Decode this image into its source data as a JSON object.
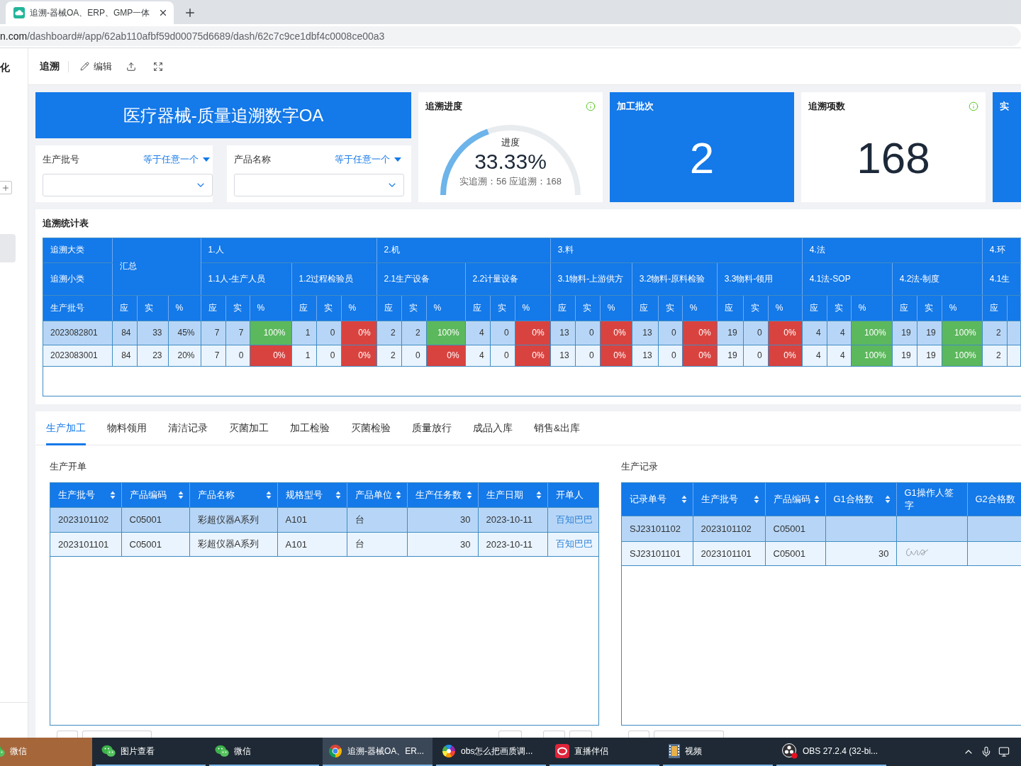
{
  "browser": {
    "tab": {
      "title": "追溯-器械OA、ERP、GMP一体"
    },
    "url": {
      "host": "n.com",
      "path": "/dashboard#/app/62ab110afbf59d00075d6689/dash/62c7c9ce1dbf4c0008ce00a3"
    }
  },
  "sidebar": {
    "title": "化",
    "items": [
      {
        "selected": true
      }
    ]
  },
  "toolbar": {
    "title": "追溯",
    "actions": [
      {
        "kind": "edit",
        "label": "编辑"
      },
      {
        "kind": "share"
      },
      {
        "kind": "fullscreen"
      }
    ]
  },
  "banner": {
    "title": "医疗器械-质量追溯数字OA"
  },
  "filters": [
    {
      "label": "生产批号",
      "operator": "等于任意一个"
    },
    {
      "label": "产品名称",
      "operator": "等于任意一个"
    }
  ],
  "progress_card": {
    "title": "追溯进度",
    "info": true,
    "caption": "进度",
    "value": "33.33%",
    "level": 0.3333,
    "detail": "实追溯：56 应追溯：168"
  },
  "stat_cards": [
    {
      "title": "加工批次",
      "value": "2",
      "kind": "filled",
      "info": false
    },
    {
      "title": "追溯项数",
      "value": "168",
      "kind": "plain",
      "info": true
    },
    {
      "title": "实",
      "kind": "filled",
      "info": false
    }
  ],
  "stats_table": {
    "title": "追溯统计表",
    "corner_labels": [
      "追溯大类",
      "追溯小类",
      "生产批号"
    ],
    "total": {
      "label": "汇总",
      "columns": [
        "应",
        "实",
        "%"
      ]
    },
    "categories": [
      {
        "label": "1.人",
        "subcategories": [
          {
            "label": "1.1人-生产人员",
            "columns": [
              "应",
              "实",
              "%"
            ]
          },
          {
            "label": "1.2过程检验员",
            "columns": [
              "应",
              "实",
              "%"
            ]
          }
        ]
      },
      {
        "label": "2.机",
        "subcategories": [
          {
            "label": "2.1生产设备",
            "columns": [
              "应",
              "实",
              "%"
            ]
          },
          {
            "label": "2.2计量设备",
            "columns": [
              "应",
              "实",
              "%"
            ]
          }
        ]
      },
      {
        "label": "3.料",
        "subcategories": [
          {
            "label": "3.1物料-上游供方",
            "columns": [
              "应",
              "实",
              "%"
            ]
          },
          {
            "label": "3.2物料-原料检验",
            "columns": [
              "应",
              "实",
              "%"
            ]
          },
          {
            "label": "3.3物料-领用",
            "columns": [
              "应",
              "实",
              "%"
            ]
          }
        ]
      },
      {
        "label": "4.法",
        "subcategories": [
          {
            "label": "4.1法-SOP",
            "columns": [
              "应",
              "实",
              "%"
            ]
          },
          {
            "label": "4.2法-制度",
            "columns": [
              "应",
              "实",
              "%"
            ]
          }
        ]
      },
      {
        "label": "4.环",
        "subcategories": [
          {
            "label": "4.1生",
            "columns": [
              "应"
            ]
          }
        ]
      }
    ],
    "rows": [
      {
        "batch": "2023082801",
        "selected": true,
        "total": {
          "due": "84",
          "done": "33",
          "percent": "45%"
        },
        "cells": [
          {
            "due": "7",
            "done": "7",
            "percent": "100%",
            "complete": true
          },
          {
            "due": "1",
            "done": "0",
            "percent": "0%",
            "complete": false
          },
          {
            "due": "2",
            "done": "2",
            "percent": "100%",
            "complete": true
          },
          {
            "due": "4",
            "done": "0",
            "percent": "0%",
            "complete": false
          },
          {
            "due": "13",
            "done": "0",
            "percent": "0%",
            "complete": false
          },
          {
            "due": "13",
            "done": "0",
            "percent": "0%",
            "complete": false
          },
          {
            "due": "19",
            "done": "0",
            "percent": "0%",
            "complete": false
          },
          {
            "due": "4",
            "done": "4",
            "percent": "100%",
            "complete": true
          },
          {
            "due": "19",
            "done": "19",
            "percent": "100%",
            "complete": true
          },
          {
            "due": "2"
          }
        ]
      },
      {
        "batch": "2023083001",
        "selected": false,
        "total": {
          "due": "84",
          "done": "23",
          "percent": "20%"
        },
        "cells": [
          {
            "due": "7",
            "done": "0",
            "percent": "0%",
            "complete": false
          },
          {
            "due": "1",
            "done": "0",
            "percent": "0%",
            "complete": false
          },
          {
            "due": "2",
            "done": "0",
            "percent": "0%",
            "complete": false
          },
          {
            "due": "4",
            "done": "0",
            "percent": "0%",
            "complete": false
          },
          {
            "due": "13",
            "done": "0",
            "percent": "0%",
            "complete": false
          },
          {
            "due": "13",
            "done": "0",
            "percent": "0%",
            "complete": false
          },
          {
            "due": "19",
            "done": "0",
            "percent": "0%",
            "complete": false
          },
          {
            "due": "4",
            "done": "4",
            "percent": "100%",
            "complete": true
          },
          {
            "due": "19",
            "done": "19",
            "percent": "100%",
            "complete": true
          },
          {
            "due": "2"
          }
        ]
      }
    ]
  },
  "tabs": [
    {
      "label": "生产加工",
      "selected": true
    },
    {
      "label": "物料领用",
      "selected": false
    },
    {
      "label": "清洁记录",
      "selected": false
    },
    {
      "label": "灭菌加工",
      "selected": false
    },
    {
      "label": "加工检验",
      "selected": false
    },
    {
      "label": "灭菌检验",
      "selected": false
    },
    {
      "label": "质量放行",
      "selected": false
    },
    {
      "label": "成品入库",
      "selected": false
    },
    {
      "label": "销售&出库",
      "selected": false
    }
  ],
  "production_orders": {
    "title": "生产开单",
    "columns": [
      {
        "label": "生产批号",
        "kind": "text",
        "sortable": true
      },
      {
        "label": "产品编码",
        "kind": "text",
        "sortable": true
      },
      {
        "label": "产品名称",
        "kind": "text",
        "sortable": true
      },
      {
        "label": "规格型号",
        "kind": "text",
        "sortable": true
      },
      {
        "label": "产品单位",
        "kind": "text",
        "sortable": true
      },
      {
        "label": "生产任务数",
        "kind": "number",
        "sortable": true
      },
      {
        "label": "生产日期",
        "kind": "text",
        "sortable": true
      },
      {
        "label": "开单人",
        "kind": "link",
        "sortable": false
      }
    ],
    "rows": [
      {
        "selected": true,
        "cells": [
          {
            "text": "2023101102"
          },
          {
            "text": "C05001"
          },
          {
            "text": "彩超仪器A系列"
          },
          {
            "text": "A101"
          },
          {
            "text": "台"
          },
          {
            "text": "30"
          },
          {
            "text": "2023-10-11"
          },
          {
            "text": "百知巴巴"
          }
        ]
      },
      {
        "selected": false,
        "cells": [
          {
            "text": "2023101101"
          },
          {
            "text": "C05001"
          },
          {
            "text": "彩超仪器A系列"
          },
          {
            "text": "A101"
          },
          {
            "text": "台"
          },
          {
            "text": "30"
          },
          {
            "text": "2023-10-11"
          },
          {
            "text": "百知巴巴"
          }
        ]
      }
    ]
  },
  "production_records": {
    "title": "生产记录",
    "columns": [
      {
        "label": "记录单号",
        "kind": "text",
        "sortable": true
      },
      {
        "label": "生产批号",
        "kind": "text",
        "sortable": true
      },
      {
        "label": "产品编码",
        "kind": "text",
        "sortable": true
      },
      {
        "label": "G1合格数",
        "kind": "number",
        "sortable": true
      },
      {
        "label": "G1操作人签字",
        "kind": "signature",
        "sortable": false
      },
      {
        "label": "G2合格数",
        "kind": "number",
        "sortable": false
      }
    ],
    "rows": [
      {
        "selected": true,
        "cells": [
          {
            "text": "SJ23101102"
          },
          {
            "text": "2023101102"
          },
          {
            "text": "C05001"
          },
          {},
          {
            "signed": false
          },
          {}
        ]
      },
      {
        "selected": false,
        "cells": [
          {
            "text": "SJ23101101"
          },
          {
            "text": "2023101101"
          },
          {
            "text": "C05001"
          },
          {
            "text": "30"
          },
          {
            "signed": true
          },
          {}
        ]
      }
    ]
  },
  "taskbar": {
    "items": [
      {
        "kind": "wechat",
        "label": "微信",
        "selected": false,
        "flashing": true
      },
      {
        "kind": "wechat",
        "label": "图片查看",
        "selected": false,
        "flashing": false
      },
      {
        "kind": "wechat",
        "label": "微信",
        "selected": false,
        "flashing": false
      },
      {
        "kind": "chrome",
        "label": "追溯-器械OA、ER...",
        "selected": true,
        "flashing": false
      },
      {
        "kind": "colorwheel",
        "label": "obs怎么把画质调...",
        "selected": false,
        "flashing": false
      },
      {
        "kind": "live",
        "label": "直播伴侣",
        "selected": false,
        "flashing": false
      },
      {
        "kind": "film",
        "label": "视频",
        "selected": false,
        "flashing": false
      },
      {
        "kind": "obs",
        "label": "OBS 27.2.4 (32-bi...",
        "selected": false,
        "flashing": false
      }
    ],
    "tray": [
      {
        "kind": "chevron"
      },
      {
        "kind": "mic"
      },
      {
        "kind": "network"
      }
    ]
  }
}
